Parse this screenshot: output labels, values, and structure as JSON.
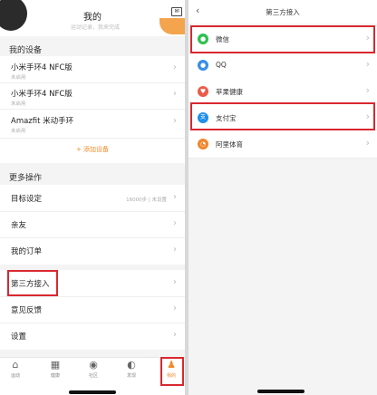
{
  "left": {
    "header": {
      "title": "我的",
      "banner_text": "运动记录，我来完成",
      "mail_glyph": "✉"
    },
    "devices": {
      "section_title": "我的设备",
      "items": [
        {
          "name": "小米手环4 NFC版",
          "status": "未启用"
        },
        {
          "name": "小米手环4 NFC版",
          "status": "未启用"
        },
        {
          "name": "Amazfit 米动手环",
          "status": "未启用"
        }
      ],
      "add_label": "+ 添加设备"
    },
    "more": {
      "section_title": "更多操作",
      "items": [
        {
          "name": "目标设定",
          "note": "16000步 | 未设置"
        },
        {
          "name": "亲友"
        },
        {
          "name": "我的订单"
        }
      ]
    },
    "other": {
      "items": [
        {
          "name": "第三方接入"
        },
        {
          "name": "意见反馈"
        },
        {
          "name": "设置"
        }
      ]
    },
    "tabbar": [
      {
        "label": "运动",
        "icon": "home-icon",
        "glyph": "⌂"
      },
      {
        "label": "健康",
        "icon": "calendar-icon",
        "glyph": "▦"
      },
      {
        "label": "社区",
        "icon": "compass-icon",
        "glyph": "◉"
      },
      {
        "label": "发现",
        "icon": "discover-icon",
        "glyph": "◐"
      },
      {
        "label": "我的",
        "icon": "profile-icon",
        "glyph": "♟"
      }
    ],
    "chevron": "›"
  },
  "right": {
    "title": "第三方接入",
    "back_glyph": "‹",
    "items": [
      {
        "name": "微信",
        "icon": "wechat-icon",
        "glyph": "●",
        "color": "#2ec050"
      },
      {
        "name": "QQ",
        "icon": "qq-icon",
        "glyph": "●",
        "color": "#3a8ee6"
      },
      {
        "name": "苹果健康",
        "icon": "apple-health-icon",
        "glyph": "♥",
        "color": "#ec5b4b"
      },
      {
        "name": "支付宝",
        "icon": "alipay-icon",
        "glyph": "支",
        "color": "#1f8fe8"
      },
      {
        "name": "阿里体育",
        "icon": "ali-sports-icon",
        "glyph": "◔",
        "color": "#f2862c"
      }
    ]
  },
  "colors": {
    "accent": "#f08a2a",
    "highlight": "#d9282f"
  }
}
